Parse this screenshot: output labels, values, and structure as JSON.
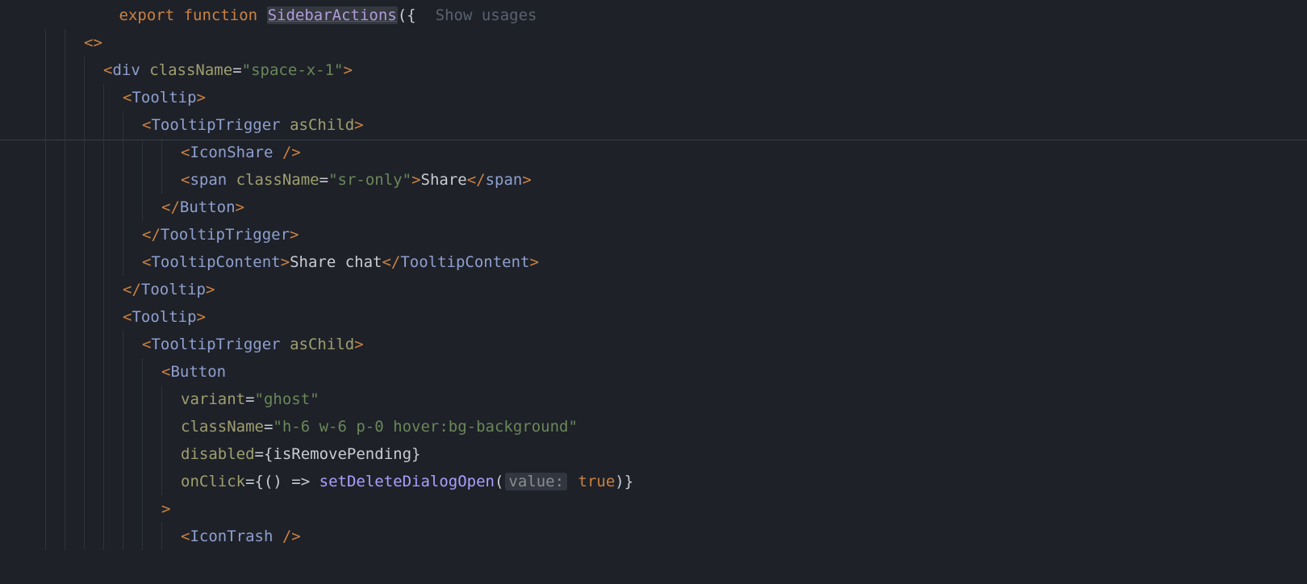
{
  "header": {
    "export_kw": "export",
    "function_kw": "function",
    "fn_name": "SidebarActions",
    "paren_brace": "({",
    "usages_hint": "Show usages"
  },
  "l2": {
    "fragment_open": "<>"
  },
  "l3": {
    "open": "<",
    "tag": "div",
    "sp": " ",
    "attr": "className",
    "eq": "=",
    "q1": "\"",
    "val": "space-x-1",
    "q2": "\"",
    "close": ">"
  },
  "l4": {
    "open": "<",
    "tag": "Tooltip",
    "close": ">"
  },
  "l5": {
    "open": "<",
    "tag": "TooltipTrigger",
    "sp": " ",
    "attr": "asChild",
    "close": ">"
  },
  "l6": {
    "open": "<",
    "tag": "IconShare",
    "sp": " ",
    "selfclose": "/>"
  },
  "l7": {
    "open": "<",
    "tag": "span",
    "sp": " ",
    "attr": "className",
    "eq": "=",
    "q1": "\"",
    "val": "sr-only",
    "q2": "\"",
    "close": ">",
    "inner": "Share",
    "endopen": "</",
    "endtag": "span",
    "endclose": ">"
  },
  "l8": {
    "endopen": "</",
    "tag": "Button",
    "close": ">"
  },
  "l9": {
    "endopen": "</",
    "tag": "TooltipTrigger",
    "close": ">"
  },
  "l10": {
    "open": "<",
    "tag": "TooltipContent",
    "close": ">",
    "inner": "Share chat",
    "endopen": "</",
    "endtag": "TooltipContent",
    "endclose": ">"
  },
  "l11": {
    "endopen": "</",
    "tag": "Tooltip",
    "close": ">"
  },
  "l12": {
    "open": "<",
    "tag": "Tooltip",
    "close": ">"
  },
  "l13": {
    "open": "<",
    "tag": "TooltipTrigger",
    "sp": " ",
    "attr": "asChild",
    "close": ">"
  },
  "l14": {
    "open": "<",
    "tag": "Button"
  },
  "l15": {
    "attr": "variant",
    "eq": "=",
    "q1": "\"",
    "val": "ghost",
    "q2": "\""
  },
  "l16": {
    "attr": "className",
    "eq": "=",
    "q1": "\"",
    "val": "h-6 w-6 p-0 hover:bg-background",
    "q2": "\""
  },
  "l17": {
    "attr": "disabled",
    "eq": "=",
    "lb": "{",
    "expr": "isRemovePending",
    "rb": "}"
  },
  "l18": {
    "attr": "onClick",
    "eq": "=",
    "lb": "{",
    "arrow": "() => ",
    "fn": "setDeleteDialogOpen",
    "lp": "(",
    "hint": "value:",
    "sp2": " ",
    "true_kw": "true",
    "rp": ")",
    "rb": "}"
  },
  "l19": {
    "close": ">"
  },
  "l20": {
    "open": "<",
    "tag": "IconTrash",
    "sp": " ",
    "selfclose": "/>"
  }
}
